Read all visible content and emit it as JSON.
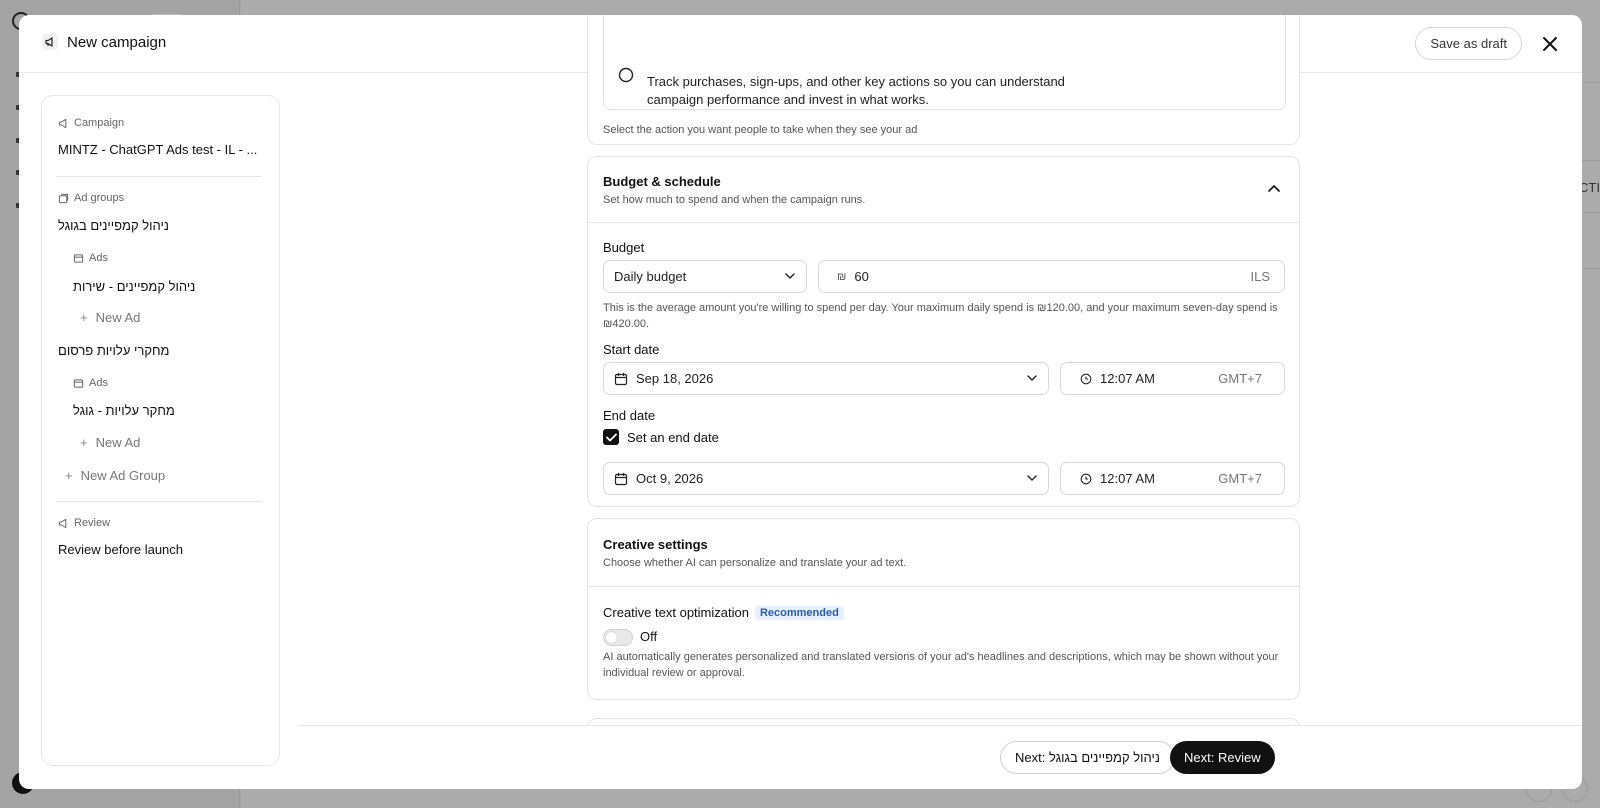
{
  "modal": {
    "title": "New campaign",
    "save_draft_label": "Save as draft"
  },
  "nav": {
    "campaign_section": "Campaign",
    "campaign_name": "MINTZ - ChatGPT Ads test - IL - ...",
    "ad_groups_section": "Ad groups",
    "ad_groups": [
      {
        "name": "ניהול קמפיינים בגוגל",
        "ads_label": "Ads",
        "ads": [
          "ניהול קמפיינים - שירות"
        ],
        "new_ad_label": "New Ad"
      },
      {
        "name": "מחקרי עלויות פרסום",
        "ads_label": "Ads",
        "ads": [
          "מחקר עלויות - גוגל"
        ],
        "new_ad_label": "New Ad"
      }
    ],
    "new_ad_group_label": "New Ad Group",
    "review_section": "Review",
    "review_item": "Review before launch"
  },
  "conversion": {
    "description_line1": "Track purchases, sign-ups, and other key actions so you can understand",
    "description_line2": "campaign performance and invest in what works.",
    "help": "Select the action you want people to take when they see your ad"
  },
  "budget_schedule": {
    "title": "Budget & schedule",
    "subtitle": "Set how much to spend and when the campaign runs.",
    "budget_label": "Budget",
    "budget_type": "Daily budget",
    "currency_symbol": "₪",
    "amount": "60",
    "currency": "ILS",
    "budget_help": "This is the average amount you're willing to spend per day. Your maximum daily spend is ₪120.00, and your maximum seven-day spend is ₪420.00.",
    "start_label": "Start date",
    "start_date": "Sep 18, 2026",
    "start_time": "12:07 AM",
    "timezone": "GMT+7",
    "end_label": "End date",
    "end_checkbox_label": "Set an end date",
    "end_date": "Oct 9, 2026",
    "end_time": "12:07 AM",
    "end_timezone": "GMT+7"
  },
  "creative": {
    "title": "Creative settings",
    "subtitle": "Choose whether AI can personalize and translate your ad text.",
    "optimization_label": "Creative text optimization",
    "badge": "Recommended",
    "toggle_state": "Off",
    "help": "AI automatically generates personalized and translated versions of your ad's headlines and descriptions, which may be shown without your individual review or approval."
  },
  "footer": {
    "next_group_label": "Next: ניהול קמפיינים בגוגל",
    "next_review_label": "Next: Review"
  },
  "background": {
    "cut_text": "CTI"
  }
}
